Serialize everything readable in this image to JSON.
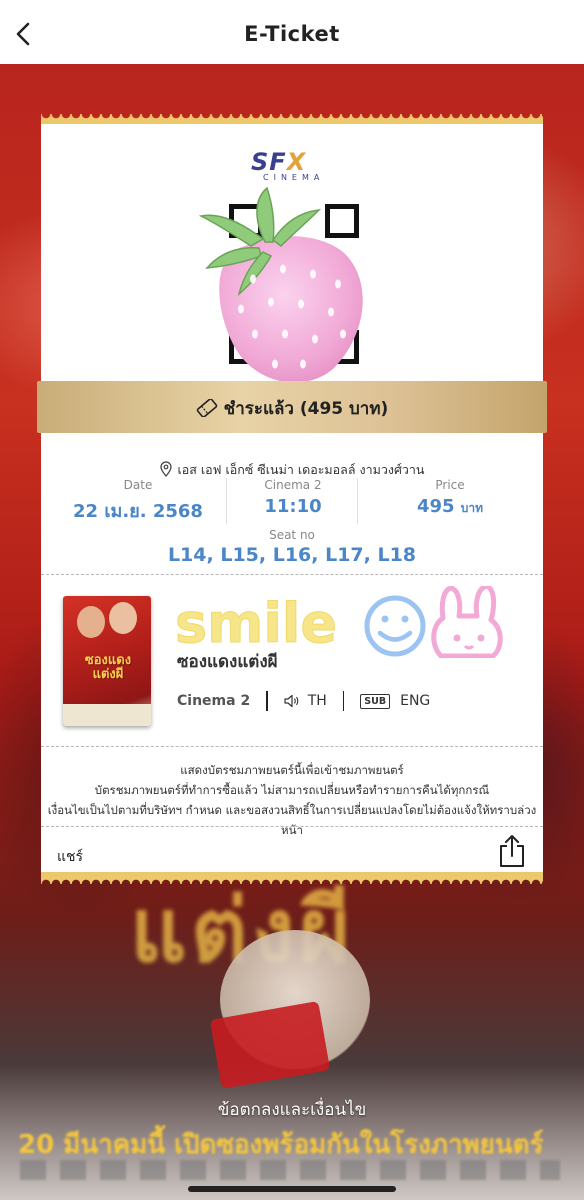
{
  "header": {
    "title": "E-Ticket",
    "back_icon": "chevron-left-icon"
  },
  "ticket": {
    "brand": {
      "main": "SF",
      "accent": "X",
      "sub": "CINEMA"
    },
    "payment_status": "ชำระแล้ว (495 บาท)",
    "location": "เอส เอฟ เอ็กซ์ ซีเนม่า เดอะมอลล์ งามวงศ์วาน",
    "date_label": "Date",
    "date_value": "22 เม.ย. 2568",
    "hall_label": "Cinema 2",
    "time_value": "11:10",
    "price_label": "Price",
    "price_value": "495",
    "price_unit": "บาท",
    "seat_label": "Seat no",
    "seat_value": "L14, L15, L16, L17, L18",
    "movie": {
      "title": "ซองแดงแต่งผี",
      "poster_title": "ซองแดง แต่งผี",
      "hall": "Cinema 2",
      "audio": "TH",
      "sub_badge": "SUB",
      "subtitle": "ENG"
    },
    "sticker_text": "smile",
    "notice_lines": [
      "แสดงบัตรชมภาพยนตร์นี้เพื่อเข้าชมภาพยนตร์",
      "บัตรชมภาพยนตร์ที่ทำการซื้อแล้ว ไม่สามารถเปลี่ยนหรือทำรายการคืนได้ทุกกรณี",
      "เงื่อนไขเป็นไปตามที่บริษัทฯ กำหนด และขอสงวนสิทธิ์ในการเปลี่ยนแปลงโดยไม่ต้องแจ้งให้ทราบล่วงหน้า"
    ],
    "share_label": "แชร์"
  },
  "background": {
    "terms_link": "ข้อตกลงและเงื่อนไข",
    "poster_big_title": "แต่งผี",
    "poster_date": "20 มีนาคมนี้ เปิดซองพร้อมกันในโรงภาพยนตร์"
  },
  "colors": {
    "accent_blue": "#4a86c8",
    "gold": "#e9c46a",
    "poster_red": "#b8251e"
  }
}
